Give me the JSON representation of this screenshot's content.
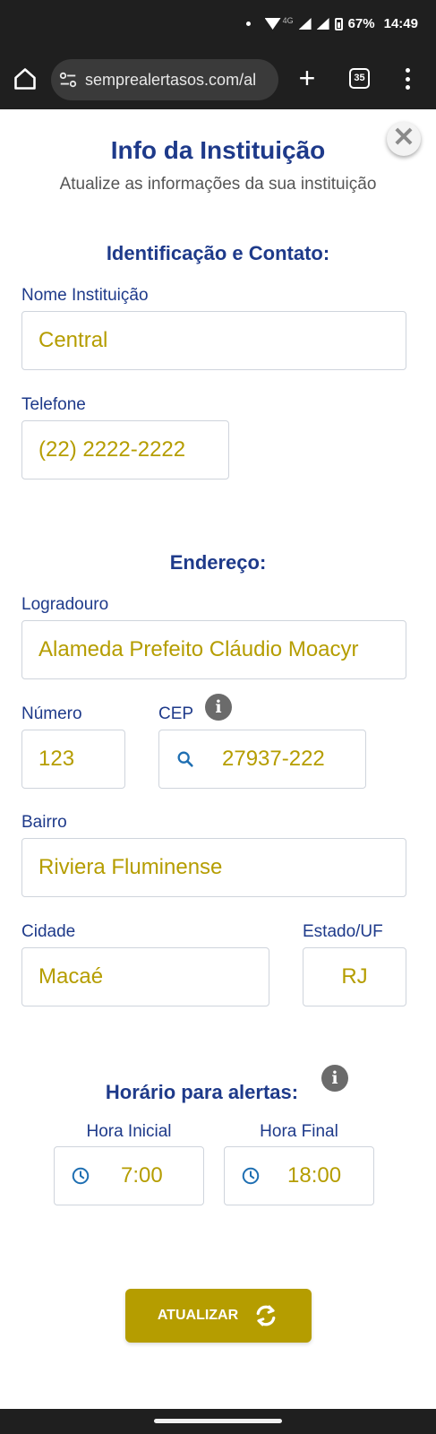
{
  "status_bar": {
    "battery": "67%",
    "time": "14:49",
    "network": "4G"
  },
  "browser": {
    "url": "semprealertasos.com/al",
    "tab_count": "35"
  },
  "header": {
    "title": "Info da Instituição",
    "subtitle": "Atualize as informações da sua instituição"
  },
  "section_contact": {
    "title": "Identificação e Contato:",
    "name_label": "Nome Instituição",
    "name_value": "Central",
    "phone_label": "Telefone",
    "phone_value": "(22) 2222-2222"
  },
  "section_address": {
    "title": "Endereço:",
    "street_label": "Logradouro",
    "street_value": "Alameda Prefeito Cláudio Moacyr",
    "number_label": "Número",
    "number_value": "123",
    "cep_label": "CEP",
    "cep_value": "27937-222",
    "district_label": "Bairro",
    "district_value": "Riviera Fluminense",
    "city_label": "Cidade",
    "city_value": "Macaé",
    "state_label": "Estado/UF",
    "state_value": "RJ"
  },
  "section_alerts": {
    "title": "Horário para alertas:",
    "start_label": "Hora Inicial",
    "start_value": "7:00",
    "end_label": "Hora Final",
    "end_value": "18:00"
  },
  "actions": {
    "update_label": "ATUALIZAR"
  },
  "colors": {
    "primary": "#1e3a8a",
    "accent": "#b59d00",
    "icon_blue": "#1f6fb2"
  }
}
